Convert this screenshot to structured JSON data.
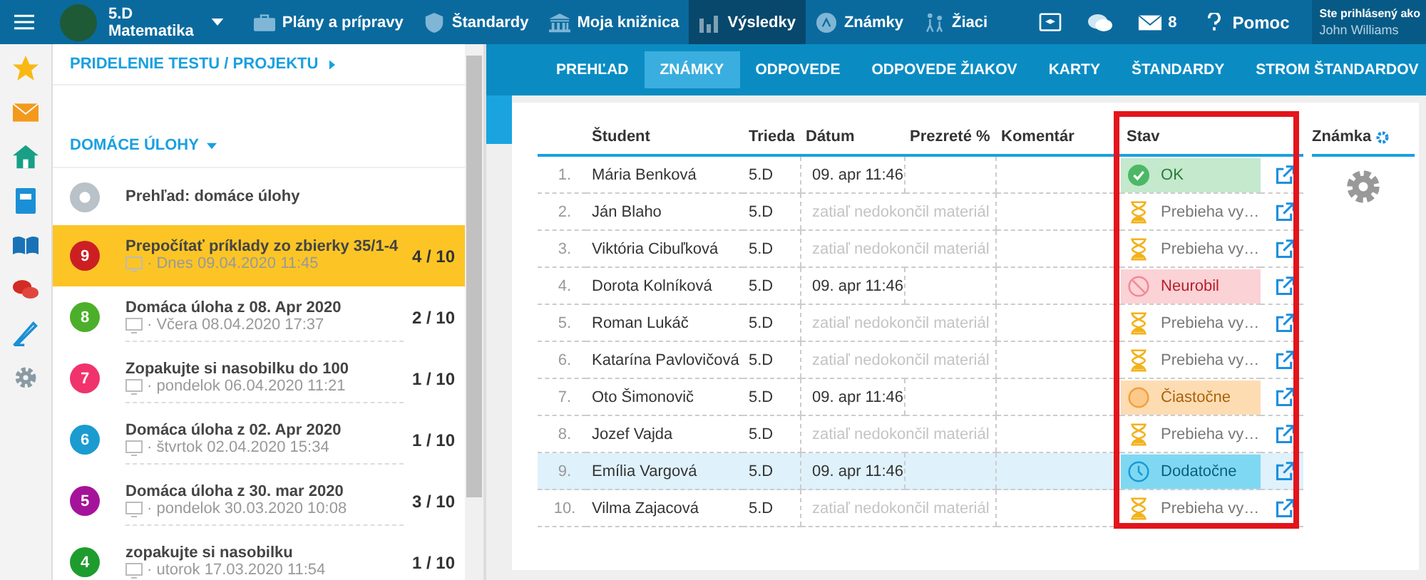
{
  "top_bar": {
    "class_name": "5.D",
    "subject": "Matematika",
    "nav": [
      {
        "label": "Plány a prípravy",
        "kind": "briefcase",
        "selected": false
      },
      {
        "label": "Štandardy",
        "kind": "shield",
        "selected": false
      },
      {
        "label": "Moja knižnica",
        "kind": "library",
        "selected": false
      },
      {
        "label": "Výsledky",
        "kind": "chart",
        "selected": true
      },
      {
        "label": "Známky",
        "kind": "grade",
        "selected": false
      },
      {
        "label": "Žiaci",
        "kind": "pupils",
        "selected": false
      }
    ],
    "message_count": "8",
    "help": "Pomoc",
    "login_label": "Ste prihlásený ako",
    "user": "John Williams"
  },
  "left_panel": {
    "assign_link": "PRIDELENIE TESTU / PROJEKTU",
    "section": "DOMÁCE ÚLOHY",
    "overview": "Prehľad: domáce úlohy",
    "items": [
      {
        "number": "9",
        "color": "#cc1f24",
        "title": "Prepočítať príklady zo zbierky 35/1-4",
        "subtitle": "· Dnes 09.04.2020 11:45",
        "count": "4 / 10",
        "selected": true
      },
      {
        "number": "8",
        "color": "#4caf2a",
        "title": "Domáca úloha z 08. Apr 2020",
        "subtitle": "· Včera 08.04.2020 17:37",
        "count": "2 / 10",
        "selected": false
      },
      {
        "number": "7",
        "color": "#f0336c",
        "title": "Zopakujte si nasobilku do 100",
        "subtitle": "· pondelok 06.04.2020 11:21",
        "count": "1 / 10",
        "selected": false
      },
      {
        "number": "6",
        "color": "#1b9bd0",
        "title": "Domáca úloha z 02. Apr 2020",
        "subtitle": "· štvrtok 02.04.2020 15:34",
        "count": "1 / 10",
        "selected": false
      },
      {
        "number": "5",
        "color": "#a4139a",
        "title": "Domáca úloha z 30. mar 2020",
        "subtitle": "· pondelok 30.03.2020 10:08",
        "count": "3 / 10",
        "selected": false
      },
      {
        "number": "4",
        "color": "#1e9c2e",
        "title": "zopakujte si nasobilku",
        "subtitle": "· utorok 17.03.2020 11:54",
        "count": "1 / 10",
        "selected": false
      }
    ]
  },
  "tabs": [
    {
      "label": "PREHĽAD",
      "selected": false
    },
    {
      "label": "ZNÁMKY",
      "selected": true
    },
    {
      "label": "ODPOVEDE",
      "selected": false
    },
    {
      "label": "ODPOVEDE ŽIAKOV",
      "selected": false
    },
    {
      "label": "KARTY",
      "selected": false
    },
    {
      "label": "ŠTANDARDY",
      "selected": false
    },
    {
      "label": "STROM ŠTANDARDOV",
      "selected": false
    }
  ],
  "table": {
    "columns": [
      "Študent",
      "Trieda",
      "Dátum",
      "Prezreté %",
      "Komentár",
      "Stav"
    ],
    "grade_column": "Známka",
    "rows": [
      {
        "index": "1.",
        "student": "Mária Benková",
        "class": "5.D",
        "date": "09. apr 11:46",
        "status": {
          "kind": "ok",
          "label": "OK"
        },
        "selected": false
      },
      {
        "index": "2.",
        "student": "Ján Blaho",
        "class": "5.D",
        "note": "zatiaľ nedokončil materiál",
        "status": {
          "kind": "pending",
          "label": "Prebieha vy…"
        },
        "selected": false
      },
      {
        "index": "3.",
        "student": "Viktória Cibuľková",
        "class": "5.D",
        "note": "zatiaľ nedokončil materiál",
        "status": {
          "kind": "pending",
          "label": "Prebieha vy…"
        },
        "selected": false
      },
      {
        "index": "4.",
        "student": "Dorota Kolníková",
        "class": "5.D",
        "date": "09. apr 11:46",
        "status": {
          "kind": "failed",
          "label": "Neurobil"
        },
        "selected": false
      },
      {
        "index": "5.",
        "student": "Roman Lukáč",
        "class": "5.D",
        "note": "zatiaľ nedokončil materiál",
        "status": {
          "kind": "pending",
          "label": "Prebieha vy…"
        },
        "selected": false
      },
      {
        "index": "6.",
        "student": "Katarína Pavlovičová",
        "class": "5.D",
        "note": "zatiaľ nedokončil materiál",
        "status": {
          "kind": "pending",
          "label": "Prebieha vy…"
        },
        "selected": false
      },
      {
        "index": "7.",
        "student": "Oto Šimonovič",
        "class": "5.D",
        "date": "09. apr 11:46",
        "status": {
          "kind": "partial",
          "label": "Čiastočne"
        },
        "selected": false
      },
      {
        "index": "8.",
        "student": "Jozef Vajda",
        "class": "5.D",
        "note": "zatiaľ nedokončil materiál",
        "status": {
          "kind": "pending",
          "label": "Prebieha vy…"
        },
        "selected": false
      },
      {
        "index": "9.",
        "student": "Emília Vargová",
        "class": "5.D",
        "date": "09. apr 11:46",
        "status": {
          "kind": "late",
          "label": "Dodatočne"
        },
        "selected": true
      },
      {
        "index": "10.",
        "student": "Vilma Zajacová",
        "class": "5.D",
        "note": "zatiaľ nedokončil materiál",
        "status": {
          "kind": "pending",
          "label": "Prebieha vy…"
        },
        "selected": false
      }
    ]
  }
}
